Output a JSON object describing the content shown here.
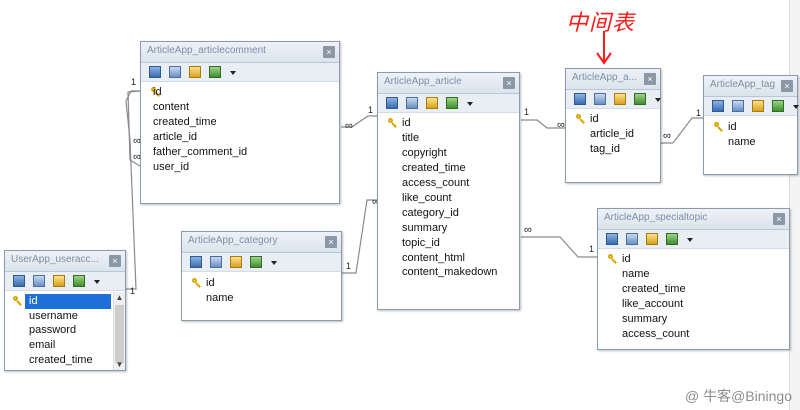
{
  "annotation": {
    "text": "中间表"
  },
  "watermark": {
    "text": "@ 牛客@Biningo"
  },
  "tables": {
    "articlecomment": {
      "title": "ArticleApp_articlecomment",
      "columns": [
        {
          "name": "id",
          "primary_key": true
        },
        {
          "name": "content"
        },
        {
          "name": "created_time"
        },
        {
          "name": "article_id"
        },
        {
          "name": "father_comment_id"
        },
        {
          "name": "user_id"
        }
      ]
    },
    "article": {
      "title": "ArticleApp_article",
      "columns": [
        {
          "name": "id",
          "primary_key": true
        },
        {
          "name": "title"
        },
        {
          "name": "copyright"
        },
        {
          "name": "created_time"
        },
        {
          "name": "access_count"
        },
        {
          "name": "like_count"
        },
        {
          "name": "category_id"
        },
        {
          "name": "summary"
        },
        {
          "name": "topic_id"
        },
        {
          "name": "content_html"
        },
        {
          "name": "content_makedown"
        }
      ]
    },
    "article_tag": {
      "title": "ArticleApp_a...",
      "columns": [
        {
          "name": "id",
          "primary_key": true
        },
        {
          "name": "article_id"
        },
        {
          "name": "tag_id"
        }
      ]
    },
    "tag": {
      "title": "ArticleApp_tag",
      "columns": [
        {
          "name": "id",
          "primary_key": true
        },
        {
          "name": "name"
        }
      ]
    },
    "category": {
      "title": "ArticleApp_category",
      "columns": [
        {
          "name": "id",
          "primary_key": true
        },
        {
          "name": "name"
        }
      ]
    },
    "specialtopic": {
      "title": "ArticleApp_specialtopic",
      "columns": [
        {
          "name": "id",
          "primary_key": true
        },
        {
          "name": "name"
        },
        {
          "name": "created_time"
        },
        {
          "name": "like_account"
        },
        {
          "name": "summary"
        },
        {
          "name": "access_count"
        }
      ]
    },
    "useraccount": {
      "title": "UserApp_useracc...",
      "columns": [
        {
          "name": "id",
          "primary_key": true,
          "selected": true
        },
        {
          "name": "username"
        },
        {
          "name": "password"
        },
        {
          "name": "email"
        },
        {
          "name": "created_time"
        }
      ]
    }
  },
  "relations": [
    {
      "from": "articlecomment",
      "to": "article",
      "from_card": "∞",
      "to_card": "1"
    },
    {
      "from": "article_tag",
      "to": "article",
      "from_card": "∞",
      "to_card": "1"
    },
    {
      "from": "article_tag",
      "to": "tag",
      "from_card": "∞",
      "to_card": "1"
    },
    {
      "from": "article",
      "to": "category",
      "from_card": "∞",
      "to_card": "1"
    },
    {
      "from": "article",
      "to": "specialtopic",
      "from_card": "∞",
      "to_card": "1"
    },
    {
      "from": "articlecomment",
      "to": "useraccount",
      "from_card": "∞",
      "to_card": "1"
    },
    {
      "from": "articlecomment",
      "to": "articlecomment",
      "from_card": "∞",
      "to_card": "1"
    }
  ]
}
